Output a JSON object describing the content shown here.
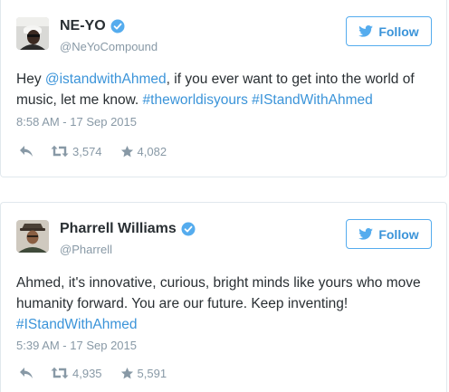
{
  "colors": {
    "link": "#3b94d9",
    "follow_border": "#55acee",
    "verified": "#55acee",
    "muted": "#8899a6",
    "text": "#292f33"
  },
  "tweets": [
    {
      "author": {
        "name": "NE-YO",
        "handle": "@NeYoCompound",
        "verified": true,
        "avatar": "avatar-photo-neyo"
      },
      "follow_label": "Follow",
      "body": {
        "t1": "Hey ",
        "l1": "@istandwithAhmed",
        "t2": ", if you ever want to get into the world of music, let me know. ",
        "l2": "#theworldisyours",
        "t3": " ",
        "l3": "#IStandWithAhmed"
      },
      "timestamp": "8:58 AM - 17 Sep 2015",
      "retweets": "3,574",
      "likes": "4,082",
      "icons": {
        "reply": "reply-icon",
        "retweet": "retweet-icon",
        "like": "star-icon",
        "follow": "twitter-bird-icon",
        "verified": "verified-badge-icon"
      }
    },
    {
      "author": {
        "name": "Pharrell Williams",
        "handle": "@Pharrell",
        "verified": true,
        "avatar": "avatar-photo-pharrell"
      },
      "follow_label": "Follow",
      "body": {
        "t1": "Ahmed, it's innovative, curious, bright minds like yours who move humanity forward. You are our future. Keep inventing! ",
        "l1": "#IStandWithAhmed"
      },
      "timestamp": "5:39 AM - 17 Sep 2015",
      "retweets": "4,935",
      "likes": "5,591",
      "icons": {
        "reply": "reply-icon",
        "retweet": "retweet-icon",
        "like": "star-icon",
        "follow": "twitter-bird-icon",
        "verified": "verified-badge-icon"
      }
    }
  ]
}
